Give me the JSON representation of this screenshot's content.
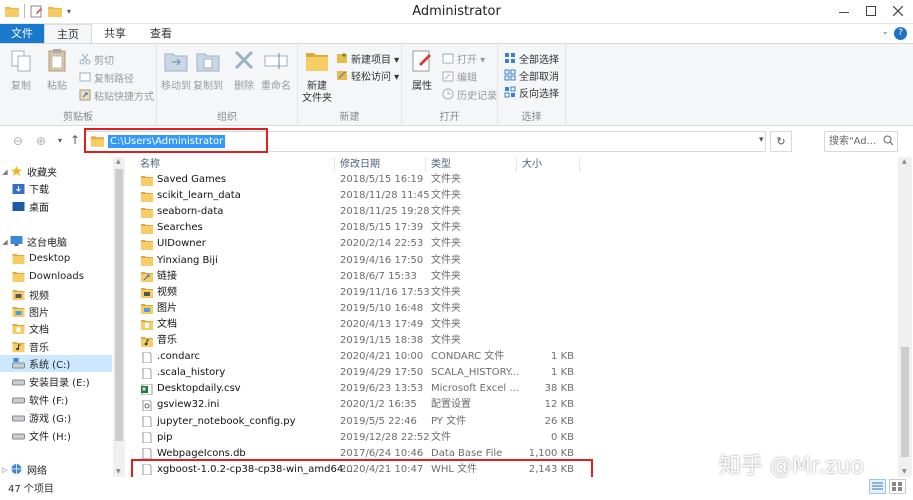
{
  "window": {
    "title": "Administrator"
  },
  "tabs": [
    "文件",
    "主页",
    "共享",
    "查看"
  ],
  "ribbon": {
    "clipboard": {
      "label": "剪贴板",
      "copy": "复制",
      "paste": "粘贴",
      "cut": "剪切",
      "copy_path": "复制路径",
      "paste_shortcut": "粘贴快捷方式"
    },
    "organize": {
      "label": "组织",
      "move_to": "移动到",
      "copy_to": "复制到",
      "delete": "删除",
      "rename": "重命名"
    },
    "new": {
      "label": "新建",
      "new_folder": "新建\n文件夹",
      "new_folder_line1": "新建",
      "new_folder_line2": "文件夹",
      "new_item": "新建项目 ▾",
      "easy_access": "轻松访问 ▾"
    },
    "open": {
      "label": "打开",
      "properties": "属性",
      "open": "打开 ▾",
      "edit": "编辑",
      "history": "历史记录"
    },
    "select": {
      "label": "选择",
      "select_all": "全部选择",
      "select_none": "全部取消",
      "invert": "反向选择"
    }
  },
  "address": {
    "path": "C:\\Users\\Administrator",
    "search_placeholder": "搜索\"Ad..."
  },
  "nav": {
    "items": [
      {
        "label": "收藏夹",
        "level": 0,
        "icon": "star-icon"
      },
      {
        "label": "下载",
        "level": 1,
        "icon": "download-folder-icon"
      },
      {
        "label": "桌面",
        "level": 1,
        "icon": "desktop-icon"
      },
      {
        "label": "这台电脑",
        "level": 0,
        "icon": "computer-icon"
      },
      {
        "label": "Desktop",
        "level": 1,
        "icon": "folder-icon"
      },
      {
        "label": "Downloads",
        "level": 1,
        "icon": "folder-icon"
      },
      {
        "label": "视频",
        "level": 1,
        "icon": "video-folder-icon"
      },
      {
        "label": "图片",
        "level": 1,
        "icon": "pictures-folder-icon"
      },
      {
        "label": "文档",
        "level": 1,
        "icon": "documents-folder-icon"
      },
      {
        "label": "音乐",
        "level": 1,
        "icon": "music-folder-icon"
      },
      {
        "label": "系统 (C:)",
        "level": 1,
        "icon": "system-drive-icon"
      },
      {
        "label": "安装目录 (E:)",
        "level": 1,
        "icon": "drive-icon"
      },
      {
        "label": "软件 (F:)",
        "level": 1,
        "icon": "drive-icon"
      },
      {
        "label": "游戏 (G:)",
        "level": 1,
        "icon": "drive-icon"
      },
      {
        "label": "文件 (H:)",
        "level": 1,
        "icon": "drive-icon"
      },
      {
        "label": "网络",
        "level": 0,
        "icon": "network-icon"
      }
    ]
  },
  "columns": {
    "name": "名称",
    "date": "修改日期",
    "type": "类型",
    "size": "大小"
  },
  "files": [
    {
      "name": "Saved Games",
      "date": "2018/5/15 16:19",
      "type": "文件夹",
      "size": "",
      "icon": "folder-icon"
    },
    {
      "name": "scikit_learn_data",
      "date": "2018/11/28 11:45",
      "type": "文件夹",
      "size": "",
      "icon": "folder-icon"
    },
    {
      "name": "seaborn-data",
      "date": "2018/11/25 19:28",
      "type": "文件夹",
      "size": "",
      "icon": "folder-icon"
    },
    {
      "name": "Searches",
      "date": "2018/5/15 17:39",
      "type": "文件夹",
      "size": "",
      "icon": "folder-icon"
    },
    {
      "name": "UIDowner",
      "date": "2020/2/14 22:53",
      "type": "文件夹",
      "size": "",
      "icon": "folder-icon"
    },
    {
      "name": "Yinxiang Biji",
      "date": "2019/4/16 17:50",
      "type": "文件夹",
      "size": "",
      "icon": "folder-icon"
    },
    {
      "name": "链接",
      "date": "2018/6/7 15:33",
      "type": "文件夹",
      "size": "",
      "icon": "links-folder-icon"
    },
    {
      "name": "视频",
      "date": "2019/11/16 17:53",
      "type": "文件夹",
      "size": "",
      "icon": "video-folder-icon"
    },
    {
      "name": "图片",
      "date": "2019/5/10 16:48",
      "type": "文件夹",
      "size": "",
      "icon": "pictures-folder-icon"
    },
    {
      "name": "文档",
      "date": "2020/4/13 17:49",
      "type": "文件夹",
      "size": "",
      "icon": "documents-folder-icon"
    },
    {
      "name": "音乐",
      "date": "2019/1/15 18:38",
      "type": "文件夹",
      "size": "",
      "icon": "music-folder-icon"
    },
    {
      "name": ".condarc",
      "date": "2020/4/21 10:00",
      "type": "CONDARC 文件",
      "size": "1 KB",
      "icon": "file-icon"
    },
    {
      "name": ".scala_history",
      "date": "2019/4/29 17:50",
      "type": "SCALA_HISTORY...",
      "size": "1 KB",
      "icon": "file-icon"
    },
    {
      "name": "Desktopdaily.csv",
      "date": "2019/6/23 13:53",
      "type": "Microsoft Excel ...",
      "size": "38 KB",
      "icon": "excel-file-icon"
    },
    {
      "name": "gsview32.ini",
      "date": "2020/1/2 16:35",
      "type": "配置设置",
      "size": "12 KB",
      "icon": "settings-file-icon"
    },
    {
      "name": "jupyter_notebook_config.py",
      "date": "2019/5/5 22:46",
      "type": "PY 文件",
      "size": "26 KB",
      "icon": "file-icon"
    },
    {
      "name": "pip",
      "date": "2019/12/28 22:52",
      "type": "文件",
      "size": "0 KB",
      "icon": "file-icon"
    },
    {
      "name": "WebpageIcons.db",
      "date": "2017/6/24 10:46",
      "type": "Data Base File",
      "size": "1,100 KB",
      "icon": "file-icon"
    },
    {
      "name": "xgboost-1.0.2-cp38-cp38-win_amd64...",
      "date": "2020/4/21 10:47",
      "type": "WHL 文件",
      "size": "2,143 KB",
      "icon": "file-icon"
    }
  ],
  "status": {
    "count": "47 个项目"
  },
  "watermark": "知乎 @Mr.zuo"
}
